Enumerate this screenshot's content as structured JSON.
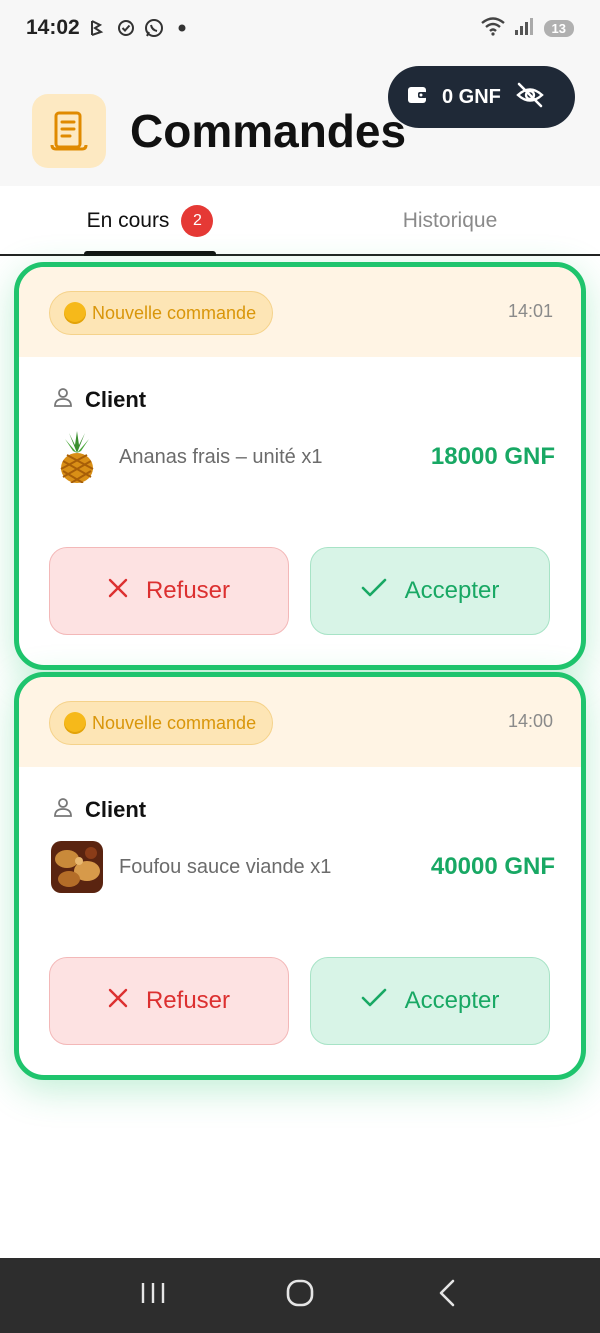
{
  "status_bar": {
    "time": "14:02",
    "battery": "13"
  },
  "header": {
    "title": "Commandes",
    "wallet_amount": "0 GNF"
  },
  "tabs": [
    {
      "label": "En cours",
      "badge": "2",
      "active": true
    },
    {
      "label": "Historique",
      "active": false
    }
  ],
  "orders": [
    {
      "status": "Nouvelle commande",
      "time": "14:01",
      "customer": "Client",
      "item": "Ananas frais – unité x1",
      "price": "18000 GNF",
      "refuse_label": "Refuser",
      "accept_label": "Accepter"
    },
    {
      "status": "Nouvelle commande",
      "time": "14:00",
      "customer": "Client",
      "item": "Foufou sauce viande x1",
      "price": "40000 GNF",
      "refuse_label": "Refuser",
      "accept_label": "Accepter"
    }
  ],
  "colors": {
    "accent_green": "#1fc46d",
    "price_green": "#18a864",
    "refuse_red": "#dc3030",
    "badge_red": "#e53935",
    "status_orange": "#d9960a"
  },
  "icons": {
    "app": "receipt-icon",
    "wallet": "wallet-icon",
    "visibility": "eye-off-icon",
    "customer": "user-icon",
    "refuse": "close-icon",
    "accept": "check-icon"
  }
}
